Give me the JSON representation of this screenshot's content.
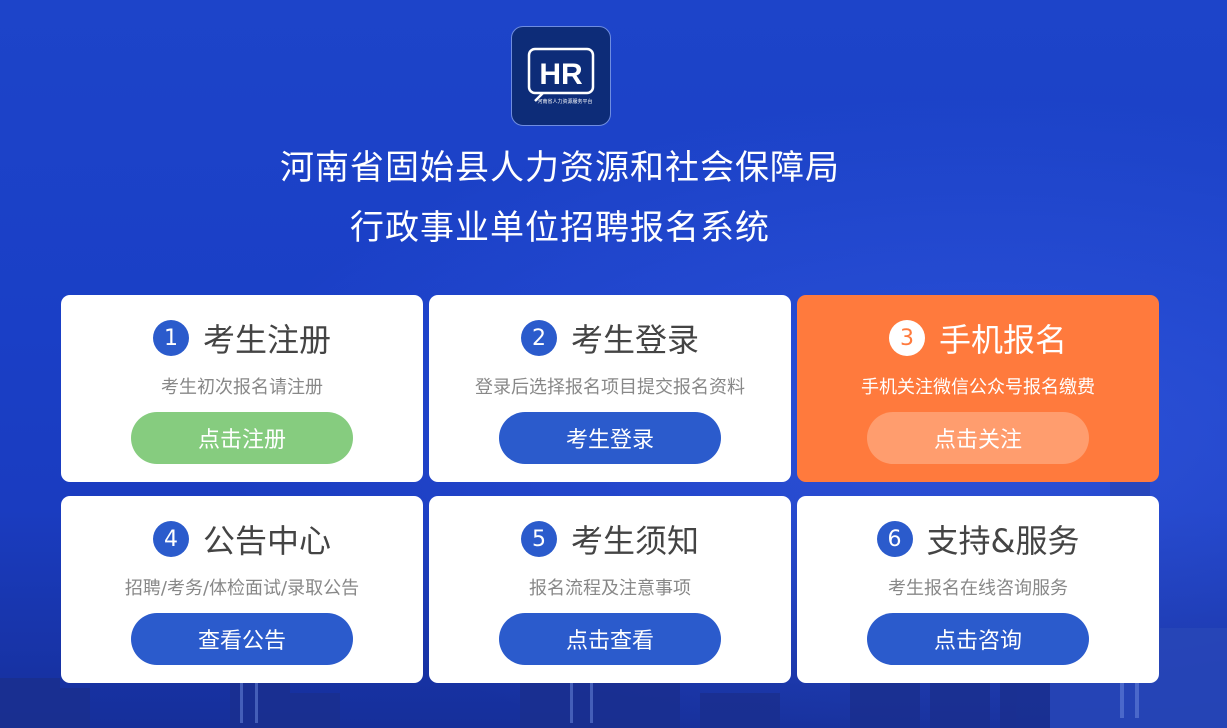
{
  "logo": {
    "text": "HR",
    "subtext": "河南省人力资源服务平台"
  },
  "header": {
    "line1": "河南省固始县人力资源和社会保障局",
    "line2": "行政事业单位招聘报名系统"
  },
  "cards": [
    {
      "num": "1",
      "title": "考生注册",
      "subtitle": "考生初次报名请注册",
      "button": "点击注册"
    },
    {
      "num": "2",
      "title": "考生登录",
      "subtitle": "登录后选择报名项目提交报名资料",
      "button": "考生登录"
    },
    {
      "num": "3",
      "title": "手机报名",
      "subtitle": "手机关注微信公众号报名缴费",
      "button": "点击关注"
    },
    {
      "num": "4",
      "title": "公告中心",
      "subtitle": "招聘/考务/体检面试/录取公告",
      "button": "查看公告"
    },
    {
      "num": "5",
      "title": "考生须知",
      "subtitle": "报名流程及注意事项",
      "button": "点击查看"
    },
    {
      "num": "6",
      "title": "支持&服务",
      "subtitle": "考生报名在线咨询服务",
      "button": "点击咨询"
    }
  ],
  "colors": {
    "background": "#1d44c9",
    "primary_button": "#2b5bcc",
    "register_button": "#86cc7f",
    "mobile_card": "#ff7a3d",
    "mobile_button": "#ff9d6e"
  }
}
